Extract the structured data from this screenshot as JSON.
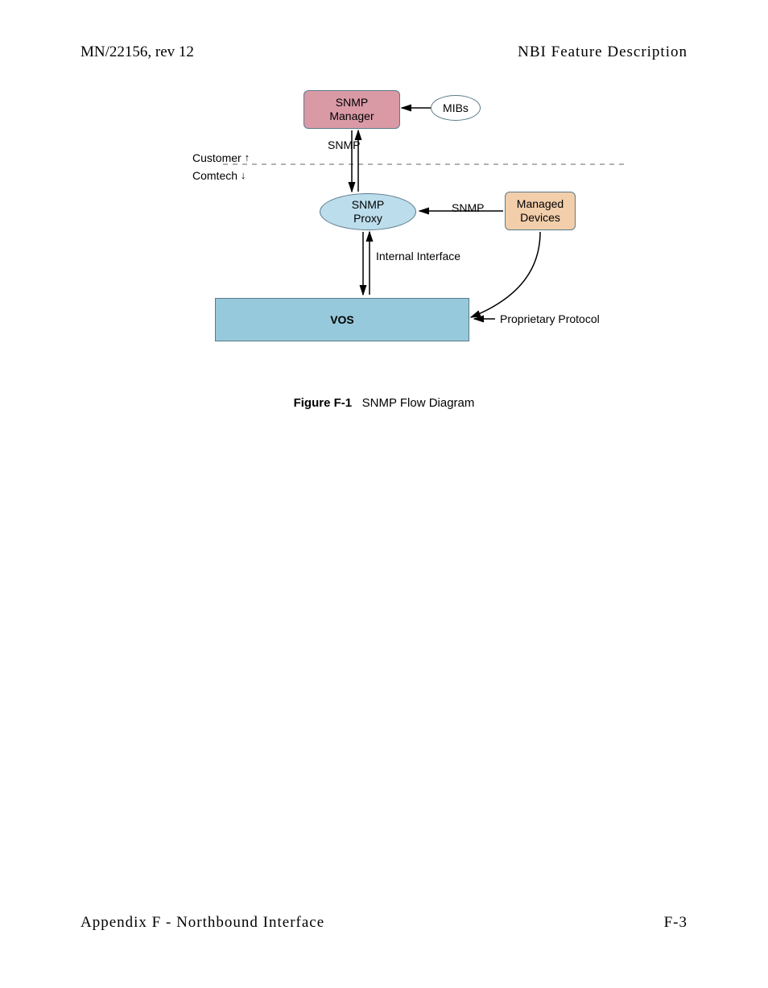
{
  "header": {
    "left": "MN/22156, rev 12",
    "right": "NBI Feature Description"
  },
  "diagram": {
    "nodes": {
      "snmp_manager": "SNMP\nManager",
      "mibs": "MIBs",
      "snmp_proxy": "SNMP\nProxy",
      "managed_devices": "Managed\nDevices",
      "vos": "VOS"
    },
    "labels": {
      "customer": "Customer",
      "comtech": "Comtech",
      "snmp_top": "SNMP",
      "snmp_mid": "SNMP",
      "internal_interface": "Internal Interface",
      "proprietary": "Proprietary Protocol"
    }
  },
  "caption": {
    "figure_label": "Figure F-1",
    "figure_title": "SNMP Flow Diagram"
  },
  "footer": {
    "left": "Appendix F - Northbound Interface",
    "right": "F-3"
  }
}
